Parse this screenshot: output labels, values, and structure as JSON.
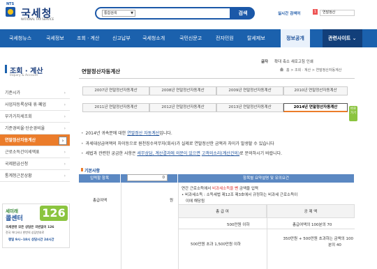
{
  "header": {
    "logo_nts": "NTS",
    "logo_text": "국세청",
    "logo_sub": "NATIONAL TAX SERVICE",
    "search_select": "통합검색",
    "search_button": "검색",
    "hot_label": "실시간 검색어",
    "hot_num": "1",
    "hot_item": "연말정산"
  },
  "nav": {
    "items": [
      "국세청뉴스",
      "국세정보",
      "조회 · 계산",
      "신고납부",
      "국세청소개",
      "국민신문고",
      "전자민원",
      "탈세제보"
    ],
    "public": "정보공개",
    "related": "관련사이트 ⌄"
  },
  "sidebar": {
    "title": "조회 · 계산",
    "subtitle": "Inquiry & Account",
    "items": [
      {
        "label": "기준시가"
      },
      {
        "label": "사업자등록상태 휴·폐업"
      },
      {
        "label": "부가가치세조회"
      },
      {
        "label": "기준경비율·단순경비율"
      },
      {
        "label": "연말정산자동계산"
      },
      {
        "label": "근로소득간이세액표"
      },
      {
        "label": "국제환급신청"
      },
      {
        "label": "통계청근본상황"
      }
    ],
    "arrow": "›"
  },
  "banner": {
    "line1": "세미래",
    "line2": "콜센터",
    "number": "126",
    "l1": "국세관련 모든 상담은 국번없이 126",
    "l2": "전국 어디서나 한번의 상담번호로",
    "l3": "평일 9시~18시 상담시간 24시간"
  },
  "main": {
    "page_title": "연말정산자동계산",
    "font_label": "글자",
    "utilities": "확대  축소  새로고침  인쇄",
    "breadcrumb": "홈 > 조회 · 계산 > 연말정산자동계산",
    "year_tabs_row1": [
      "2007년 연말정산자동계산",
      "2008년 연말정산자동계산",
      "2009년 연말정산자동계산",
      "2010년 연말정산자동계산"
    ],
    "year_tabs_row2": [
      "2011년 연말정산자동계산",
      "2012년 연말정산자동계산",
      "2013년 연말정산자동계산",
      "2014년 연말정산자동계산"
    ],
    "side_tab": "바로가기",
    "bullets": {
      "b1_pre": "2014년 귀속분에 대한 ",
      "b1_link": "연말정산 자동계산",
      "b1_post": "입니다.",
      "b2": "과세대상급여액의 차이등으로 원천징수의무자(회사)가 실제로 연말정산한 금액과 차이가 발생할 수 있습니다",
      "b3_pre": "세법과 관련한 궁금한 사항은 ",
      "b3_link1": "세무상담, 계산결과에 의문이 있으면",
      "b3_link2": "고객의소리(계산건의)",
      "b3_post": "로 문의하시기 바랍니다."
    },
    "section_title": "기본사항",
    "table": {
      "headers": [
        "입력할 항목",
        "선택 또는 입력",
        "항목별 요약설명 및 유의요건"
      ],
      "row1_label": "총급여액",
      "row1_value": "0",
      "row1_unit": "원",
      "desc1_pre": "연간 근로소득에서 ",
      "desc1_link": "비과세소득을 뺀",
      "desc1_post": " 금액을 입력",
      "desc2": "• 비과세소득 : 소득세법 제12조 제3호에서 규정하는 비과세 근로소득이",
      "desc3": "이에 해당됨",
      "sub_headers": [
        "총 급 여",
        "공 제 액"
      ],
      "sub_rows": [
        [
          "500만원 이하",
          "총급여액의 100분의 70"
        ],
        [
          "500만원 초과 1,500만원 이하",
          "350만원 + 500만원 초과하는 금액의 100",
          "분의 40"
        ]
      ]
    }
  },
  "colors": {
    "brand_blue": "#1b61ad",
    "active_orange": "#eb7c2a",
    "banner_green": "#8bc43f"
  }
}
